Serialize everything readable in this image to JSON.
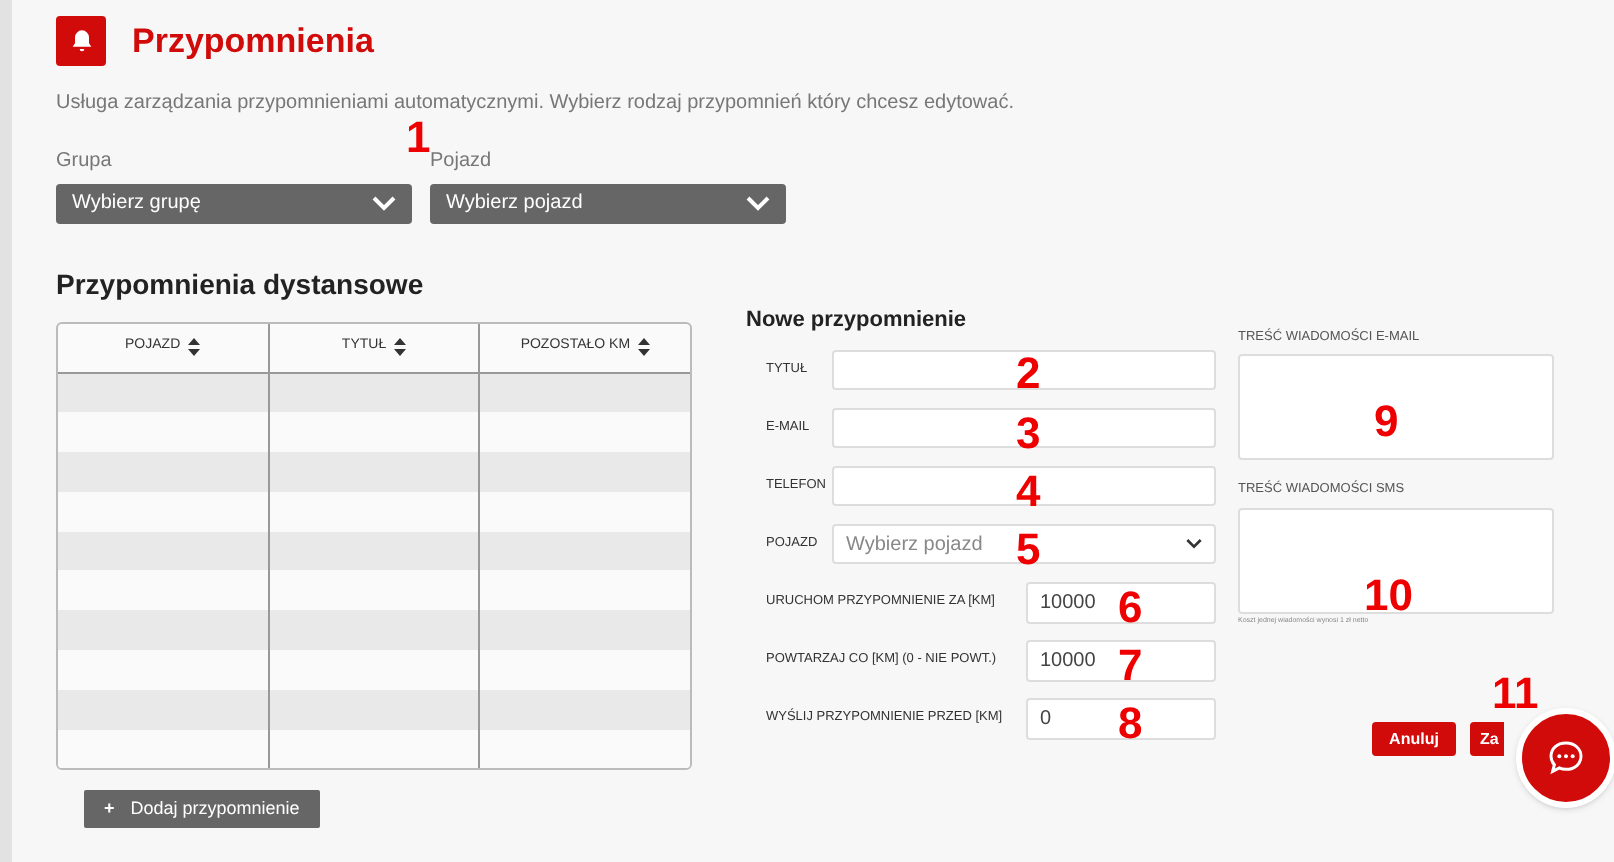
{
  "header": {
    "title": "Przypomnienia",
    "description": "Usługa zarządzania przypomnieniami automatycznymi. Wybierz rodzaj przypomnień który chcesz edytować."
  },
  "filters": [
    {
      "label": "Grupa",
      "value": "Wybierz grupę"
    },
    {
      "label": "Pojazd",
      "value": "Wybierz pojazd"
    }
  ],
  "table": {
    "title": "Przypomnienia dystansowe",
    "columns": [
      "POJAZD",
      "TYTUŁ",
      "POZOSTAŁO KM"
    ]
  },
  "add_button": {
    "label": "Dodaj przypomnienie",
    "icon": "+"
  },
  "form": {
    "title": "Nowe przypomnienie",
    "fields": [
      {
        "kind": "text",
        "label": "TYTUŁ"
      },
      {
        "kind": "text",
        "label": "E-MAIL"
      },
      {
        "kind": "text",
        "label": "TELEFON"
      },
      {
        "kind": "select",
        "label": "POJAZD",
        "placeholder": "Wybierz pojazd"
      },
      {
        "kind": "number",
        "label": "URUCHOM PRZYPOMNIENIE ZA [KM]",
        "value": "10000"
      },
      {
        "kind": "number",
        "label": "POWTARZAJ CO [KM] (0 - NIE POWT.)",
        "value": "10000"
      },
      {
        "kind": "number",
        "label": "WYŚLIJ PRZYPOMNIENIE PRZED [KM]",
        "value": "0"
      }
    ],
    "messages": [
      {
        "label": "TREŚĆ WIADOMOŚCI E-MAIL"
      },
      {
        "label": "TREŚĆ WIADOMOŚCI SMS",
        "note": "Koszt jednej wiadomości wynosi 1 zł netto"
      }
    ],
    "buttons": [
      "Anuluj",
      "Za"
    ]
  },
  "annotations": [
    "1",
    "2",
    "3",
    "4",
    "5",
    "6",
    "7",
    "8",
    "9",
    "10",
    "11"
  ]
}
